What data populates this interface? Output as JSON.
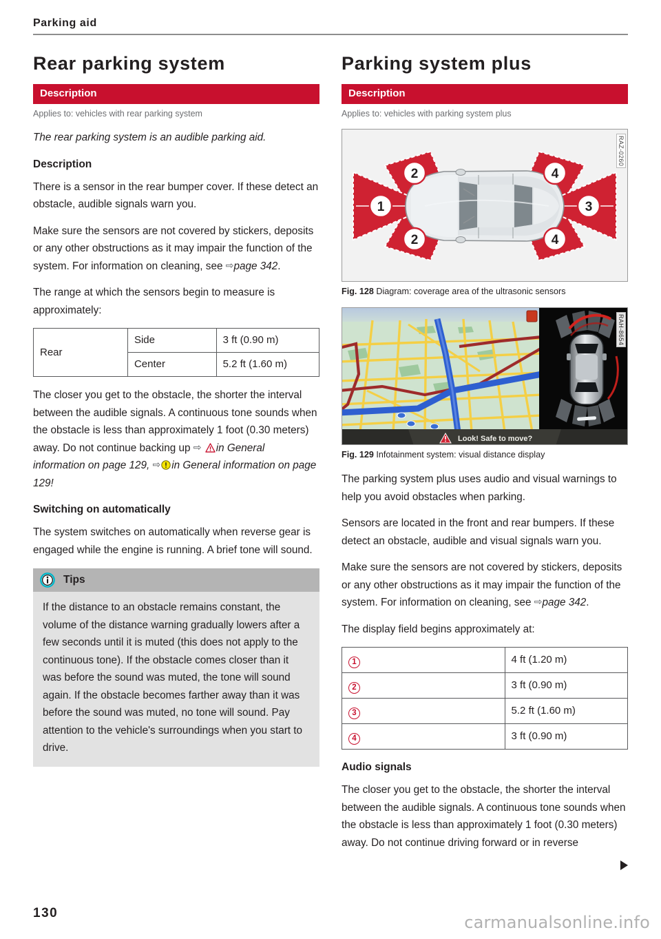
{
  "running_head": {
    "title": "Parking aid"
  },
  "left_column": {
    "section_title": "Rear parking system",
    "description_bar": "Description",
    "applies_to": "Applies to: vehicles with rear parking system",
    "lead_italic": "The rear parking system is an audible parking aid.",
    "sub_head_description": "Description",
    "para_1": "There is a sensor in the rear bumper cover. If these detect an obstacle, audible signals warn you.",
    "para_2_a": "Make sure the sensors are not covered by stickers, deposits or any other obstructions as it may impair the function of the system. For information on cleaning, see ",
    "para_2_ref": "page 342",
    "para_2_end": ".",
    "para_3": "The range at which the sensors begin to measure is approximately:",
    "range_table": {
      "row_label": "Rear",
      "rows": [
        {
          "position": "Side",
          "distance": "3 ft (0.90 m)"
        },
        {
          "position": "Center",
          "distance": "5.2 ft (1.60 m)"
        }
      ]
    },
    "para_4_a": "The closer you get to the obstacle, the shorter the interval between the audible signals. A continuous tone sounds when the obstacle is less than approximately 1 foot (0.30 meters) away. Do not continue backing up ",
    "para_4_ref_1": "in General information on page 129",
    "para_4_mid": ", ",
    "para_4_ref_2": "in General information on page 129",
    "para_4_end": "!",
    "sub_head_switching": "Switching on automatically",
    "para_5": "The system switches on automatically when reverse gear is engaged while the engine is running. A brief tone will sound.",
    "tips": {
      "label": "Tips",
      "icon": "info-circle-icon",
      "body": "If the distance to an obstacle remains constant, the volume of the distance warning gradually lowers after a few seconds until it is muted (this does not apply to the continuous tone). If the obstacle comes closer than it was before the sound was muted, the tone will sound again. If the obstacle becomes farther away than it was before the sound was muted, no tone will sound. Pay attention to the vehicle's surroundings when you start to drive."
    }
  },
  "right_column": {
    "section_title": "Parking system plus",
    "description_bar": "Description",
    "applies_to": "Applies to: vehicles with parking system plus",
    "figure_128": {
      "number": "Fig. 128",
      "caption": "Diagram: coverage area of the ultrasonic sensors",
      "watermark": "RAZ-0260",
      "zone_labels": [
        "1",
        "2",
        "2",
        "3",
        "4",
        "4"
      ]
    },
    "figure_129": {
      "number": "Fig. 129",
      "caption": "Infotainment system: visual distance display",
      "watermark": "RAH-8654",
      "screen_banner": "Look! Safe to move?"
    },
    "para_1": "The parking system plus uses audio and visual warnings to help you avoid obstacles when parking.",
    "para_2": "Sensors are located in the front and rear bumpers. If these detect an obstacle, audible and visual signals warn you.",
    "para_3_a": "Make sure the sensors are not covered by stickers, deposits or any other obstructions as it may impair the function of the system. For information on cleaning, see ",
    "para_3_ref": "page 342",
    "para_3_end": ".",
    "para_4": "The display field begins approximately at:",
    "display_table": {
      "rows": [
        {
          "marker": "1",
          "distance": "4 ft (1.20 m)"
        },
        {
          "marker": "2",
          "distance": "3 ft (0.90 m)"
        },
        {
          "marker": "3",
          "distance": "5.2 ft (1.60 m)"
        },
        {
          "marker": "4",
          "distance": "3 ft (0.90 m)"
        }
      ]
    },
    "sub_head_audio": "Audio signals",
    "para_5": "The closer you get to the obstacle, the shorter the interval between the audible signals. A continuous tone sounds when the obstacle is less than approximately 1 foot (0.30 meters) away. Do not continue driving forward or in reverse"
  },
  "footer": {
    "page_number": "130",
    "watermark": "carmanualsonline.info"
  },
  "colors": {
    "accent_red": "#c8102e",
    "bar_gray": "#b4b4b4",
    "tips_body_gray": "#e2e2e2",
    "rule_gray": "#8d8d8d",
    "muted_text": "#6d6e71"
  }
}
